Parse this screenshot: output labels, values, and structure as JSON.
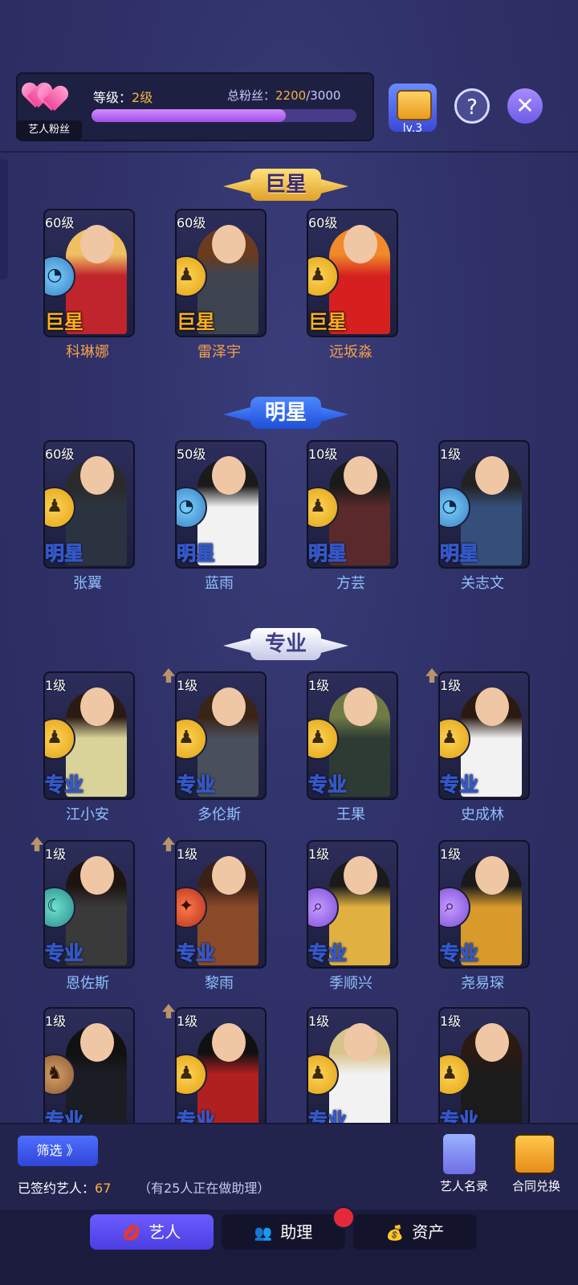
{
  "header": {
    "fan_label": "艺人粉丝",
    "level_prefix": "等级：",
    "level_value": "2级",
    "fans_prefix": "总粉丝：",
    "fans_current": "2200",
    "fans_total": "/3000",
    "fans_progress": 0.733,
    "studio_level": "lv.3",
    "help_icon": "question-icon",
    "close_icon": "close-icon"
  },
  "sections": {
    "superstar": "巨星",
    "star": "明星",
    "pro": "专业"
  },
  "artists": [
    {
      "name": "科琳娜",
      "level": "60级",
      "rank": "巨星",
      "emblem": "ufo",
      "hair": "#f0c060",
      "outfit": "#c0242c"
    },
    {
      "name": "雷泽宇",
      "level": "60级",
      "rank": "巨星",
      "emblem": "soldier",
      "hair": "#6a3b1f",
      "outfit": "#3d4450"
    },
    {
      "name": "远坂淼",
      "level": "60级",
      "rank": "巨星",
      "emblem": "soldier",
      "hair": "#f08a2a",
      "outfit": "#d62020"
    },
    {
      "name": "张翼",
      "level": "60级",
      "rank": "明星",
      "emblem": "soldier",
      "hair": "#2a2a2a",
      "outfit": "#2c3340"
    },
    {
      "name": "蓝雨",
      "level": "50级",
      "rank": "明星",
      "emblem": "ufo",
      "hair": "#1a1a1a",
      "outfit": "#f2f2f2"
    },
    {
      "name": "方芸",
      "level": "10级",
      "rank": "明星",
      "emblem": "soldier",
      "hair": "#1a1a1a",
      "outfit": "#5a2a2a"
    },
    {
      "name": "关志文",
      "level": "1级",
      "rank": "明星",
      "emblem": "ufo",
      "hair": "#222",
      "outfit": "#34507a"
    },
    {
      "name": "江小安",
      "level": "1级",
      "rank": "专业",
      "emblem": "soldier",
      "hair": "#2a1a12",
      "outfit": "#d9d39a"
    },
    {
      "name": "多伦斯",
      "level": "1级",
      "rank": "专业",
      "emblem": "soldier",
      "hair": "#3a2415",
      "outfit": "#4a4f5c",
      "upgrade": true
    },
    {
      "name": "王果",
      "level": "1级",
      "rank": "专业",
      "emblem": "soldier",
      "hair": "#6f7a45",
      "outfit": "#2e3b34"
    },
    {
      "name": "史成林",
      "level": "1级",
      "rank": "专业",
      "emblem": "soldier",
      "hair": "#2a1a12",
      "outfit": "#f2f2f2",
      "upgrade": true
    },
    {
      "name": "恩佐斯",
      "level": "1级",
      "rank": "专业",
      "emblem": "night",
      "hair": "#1d140f",
      "outfit": "#3a3a3a",
      "upgrade": true
    },
    {
      "name": "黎雨",
      "level": "1级",
      "rank": "专业",
      "emblem": "red",
      "hair": "#3a2015",
      "outfit": "#8a4a2a",
      "upgrade": true
    },
    {
      "name": "季顺兴",
      "level": "1级",
      "rank": "专业",
      "emblem": "magnifier",
      "hair": "#1a1a1a",
      "outfit": "#e0b040"
    },
    {
      "name": "尧易琛",
      "level": "1级",
      "rank": "专业",
      "emblem": "magnifier",
      "hair": "#1a1a1a",
      "outfit": "#d89a2a"
    },
    {
      "name": "",
      "level": "1级",
      "rank": "专业",
      "emblem": "desert",
      "hair": "#111",
      "outfit": "#1b1d25"
    },
    {
      "name": "",
      "level": "1级",
      "rank": "专业",
      "emblem": "soldier",
      "hair": "#111",
      "outfit": "#b02020",
      "upgrade": true
    },
    {
      "name": "",
      "level": "1级",
      "rank": "专业",
      "emblem": "soldier",
      "hair": "#d8c38a",
      "outfit": "#f2f2f2"
    },
    {
      "name": "",
      "level": "1级",
      "rank": "专业",
      "emblem": "soldier",
      "hair": "#2a1a12",
      "outfit": "#1b1b1b"
    }
  ],
  "footer": {
    "filter_label": "筛选 》",
    "signed_prefix": "已签约艺人：",
    "signed_count": "67",
    "assist_note": "（有25人正在做助理）",
    "roster_label": "艺人名录",
    "contract_label": "合同兑换"
  },
  "nav": {
    "tab_artist": "艺人",
    "tab_assistant": "助理",
    "tab_assets": "资产"
  },
  "colors": {
    "accent_gold": "#f4b341",
    "accent_blue": "#4e6fff",
    "background": "#2f3168"
  }
}
